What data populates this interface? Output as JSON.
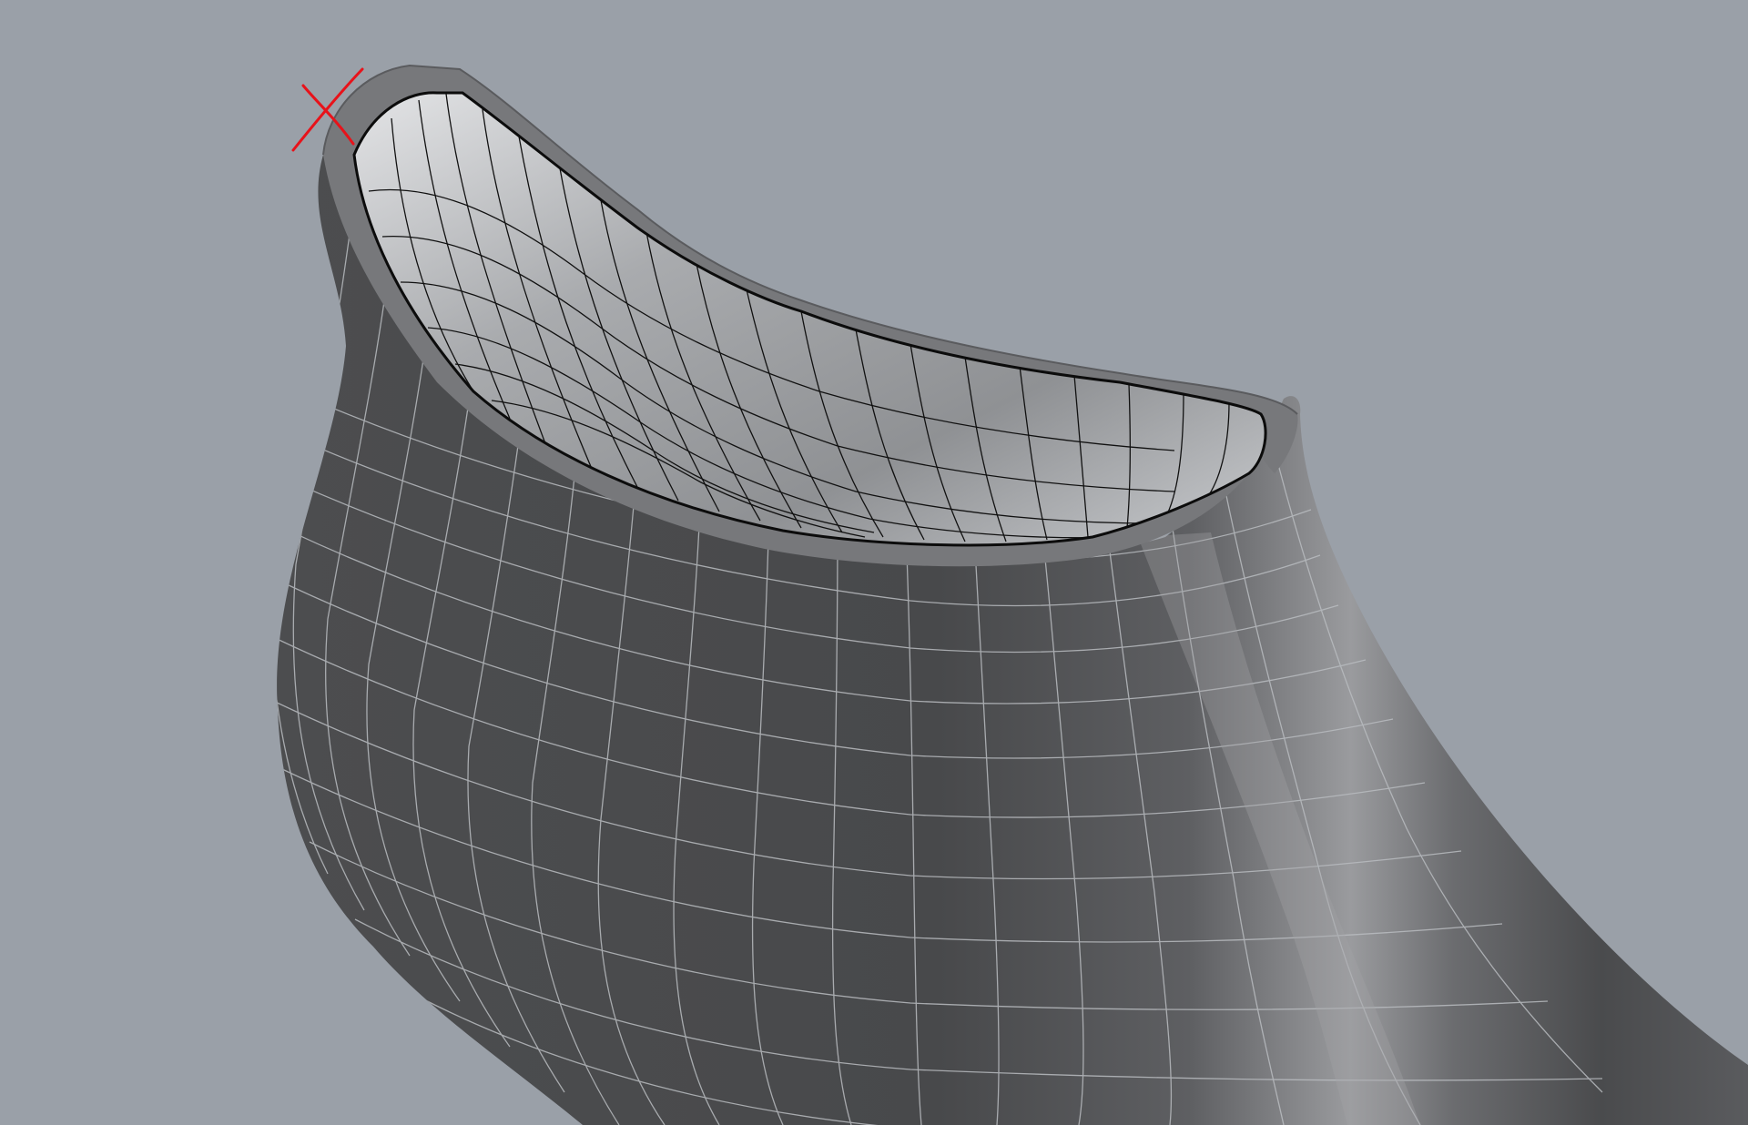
{
  "viewport": {
    "background_color": "#9aa0a8",
    "display_mode": "shaded-with-wireframe",
    "model": {
      "shell_outer_color": "#4a4b4d",
      "shell_highlight_color": "#8e8f92",
      "shell_inner_color": "#c7c9cc",
      "rim_color": "#77787b",
      "outer_wire_color": "#b9bcc0",
      "inner_wire_color": "#111111",
      "edge_curve_color": "#0c0c0c"
    },
    "annotation": {
      "shape": "hand-drawn-x",
      "color": "#e8121a"
    }
  }
}
